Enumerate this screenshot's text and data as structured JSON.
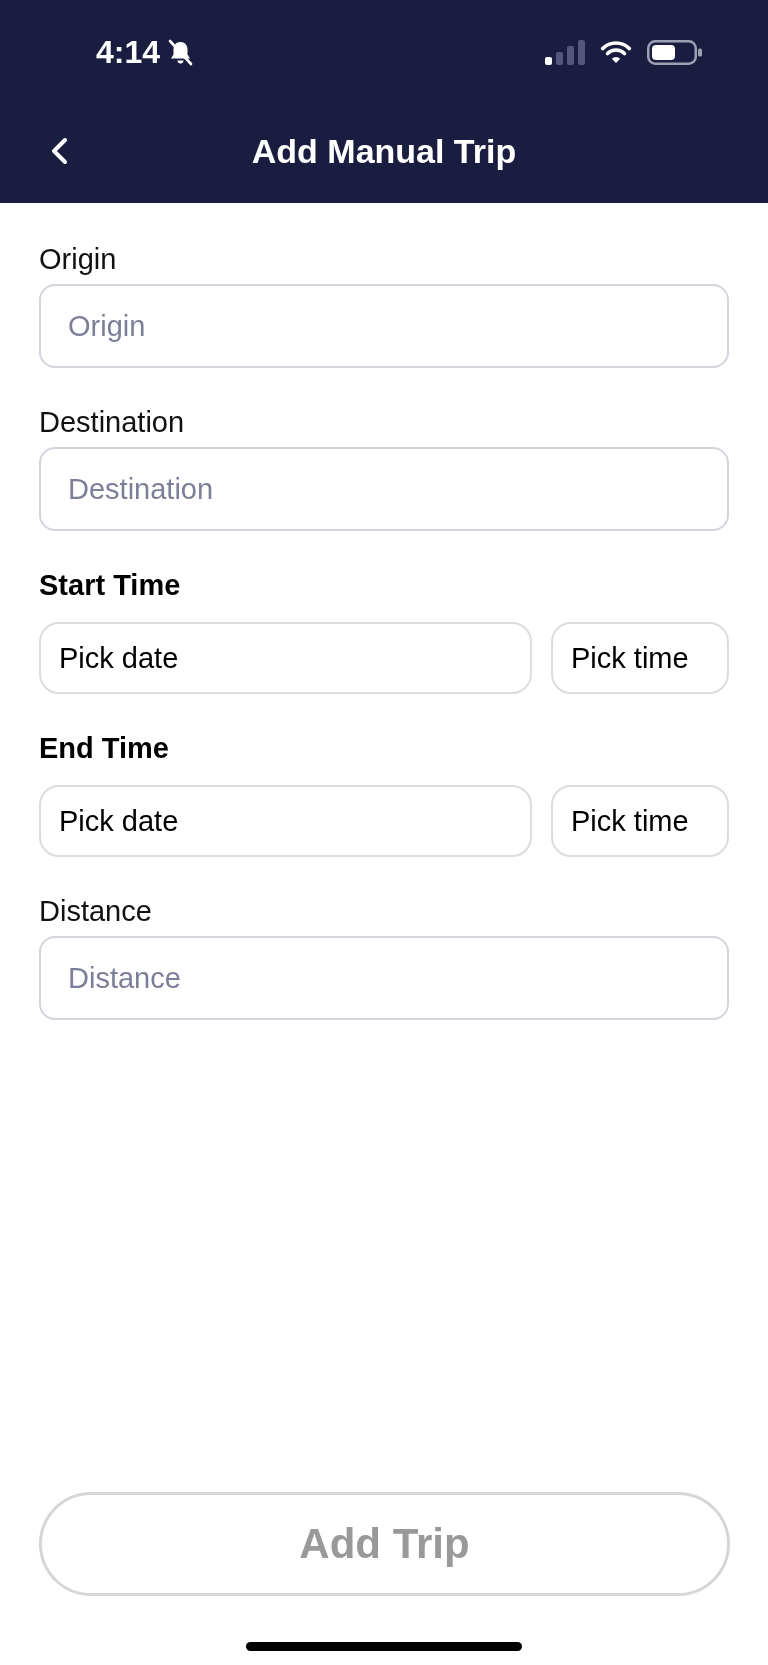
{
  "status_bar": {
    "time": "4:14"
  },
  "header": {
    "title": "Add Manual Trip"
  },
  "fields": [
    {
      "kind": "text",
      "label": "Origin",
      "placeholder": "Origin"
    },
    {
      "kind": "text",
      "label": "Destination",
      "placeholder": "Destination"
    },
    {
      "kind": "datetime",
      "label": "Start Time",
      "date": "Pick date",
      "time": "Pick time"
    },
    {
      "kind": "datetime",
      "label": "End Time",
      "date": "Pick date",
      "time": "Pick time"
    },
    {
      "kind": "text",
      "label": "Distance",
      "placeholder": "Distance"
    }
  ],
  "submit_button": {
    "label": "Add Trip",
    "disabled": true
  }
}
